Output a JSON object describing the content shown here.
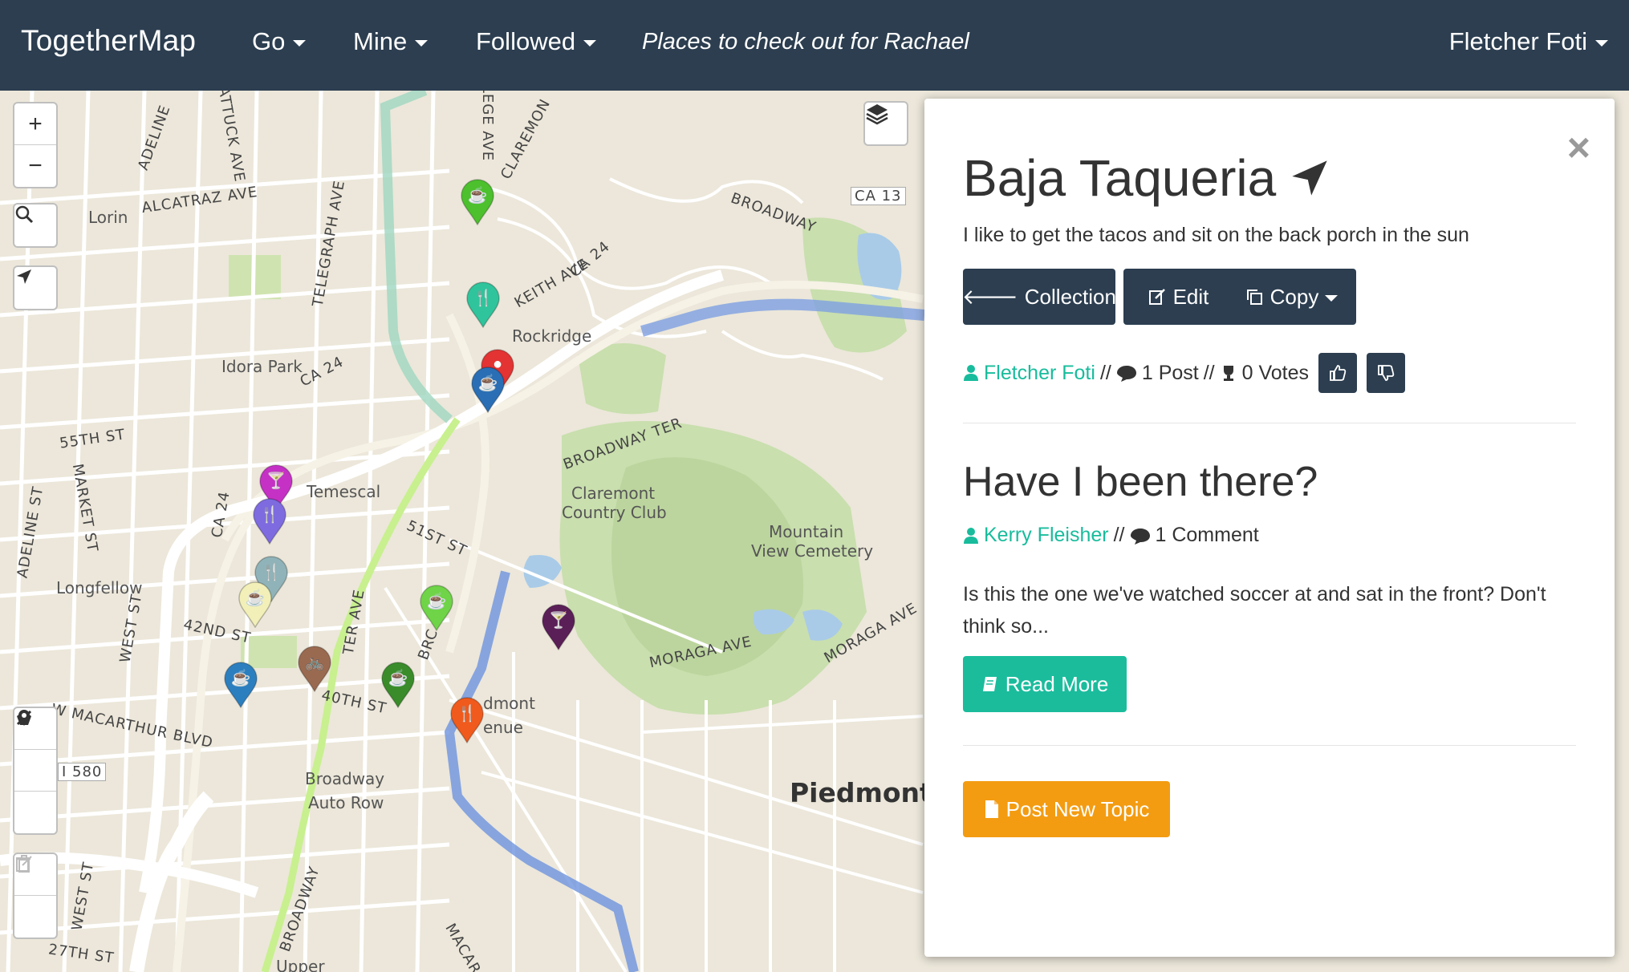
{
  "nav": {
    "brand": "TogetherMap",
    "go": "Go",
    "mine": "Mine",
    "followed": "Followed",
    "map_title": "Places to check out for Rachael",
    "user": "Fletcher Foti",
    "bg_color": "#2c3e50"
  },
  "map": {
    "controls": {
      "zoom_in": "+",
      "zoom_out": "−"
    },
    "labels": {
      "rockridge": "Rockridge",
      "idora_park": "Idora Park",
      "temescal": "Temescal",
      "longfellow": "Longfellow",
      "claremont": "Claremont",
      "country_club": "Country Club",
      "mountain": "Mountain",
      "view_cemetery": "View Cemetery",
      "piedmont": "Piedmont",
      "broadway": "Broadway",
      "auto_row": "Auto Row",
      "piedmont_ave_1": "dmont",
      "piedmont_ave_2": "enue",
      "upper": "Upper",
      "lorin": "Lorin",
      "alcatraz": "ALCATRAZ AVE",
      "adeline": "ADELINE",
      "telegraph": "TELEGRAPH AVE",
      "st_55": "55TH ST",
      "market": "MARKET ST",
      "st_51": "51ST ST",
      "st_42": "42ND ST",
      "st_40": "40TH ST",
      "macarthur": "W MACARTHUR BLVD",
      "i580": "I 580",
      "broadway_ter": "BROADWAY TER",
      "broadway_st": "BROADWAY",
      "keith": "KEITH AVE",
      "ca24_a": "CA 24",
      "ca24_b": "CA 24",
      "ca24_c": "CA 24",
      "ca13": "CA 13",
      "moraga_1": "MORAGA AVE",
      "moraga_2": "MORAGA AVE",
      "west_st": "WEST ST",
      "west_st2": "WEST ST",
      "st_27": "27TH ST",
      "claremont_ave": "CLAREMON",
      "college": "LEGE AVE",
      "shattuck": "ATTUCK AVE",
      "adeline_st": "ADELINE ST",
      "broadway_s": "BROADWAY",
      "macar": "MACAR",
      "ter_ave": "TER AVE",
      "brc": "BRC"
    },
    "markers": [
      {
        "color": "#4cc02d",
        "icon": "coffee-icon"
      },
      {
        "color": "#2fc49c",
        "icon": "fork-knife-icon"
      },
      {
        "color": "#e33333",
        "icon": "pin-icon"
      },
      {
        "color": "#2a6fb5",
        "icon": "coffee-icon"
      },
      {
        "color": "#c531c5",
        "icon": "cocktail-icon"
      },
      {
        "color": "#7e6be0",
        "icon": "fork-knife-icon"
      },
      {
        "color": "#8fb3b8",
        "icon": "fork-knife-icon"
      },
      {
        "color": "#f2f0b8",
        "icon": "coffee-icon"
      },
      {
        "color": "#6fd447",
        "icon": "coffee-icon"
      },
      {
        "color": "#5b1f58",
        "icon": "cocktail-icon"
      },
      {
        "color": "#2c7fbf",
        "icon": "coffee-icon"
      },
      {
        "color": "#9a6a50",
        "icon": "bicycle-icon"
      },
      {
        "color": "#3a8c2a",
        "icon": "coffee-icon"
      },
      {
        "color": "#f05a1c",
        "icon": "fork-knife-icon"
      }
    ]
  },
  "panel": {
    "place_title": "Baja Taqueria",
    "description": "I like to get the tacos and sit on the back porch in the sun",
    "buttons": {
      "collection": "Collection",
      "edit": "Edit",
      "copy": "Copy"
    },
    "meta": {
      "author": "Fletcher Foti",
      "sep1": "//",
      "posts": "1 Post",
      "sep2": "//",
      "votes": "0 Votes"
    },
    "topic": {
      "title": "Have I been there?",
      "author": "Kerry Fleisher",
      "sep": "//",
      "comments": "1 Comment",
      "body": "Is this the one we've watched soccer at and sat in the front? Don't think so...",
      "read_more": "Read More"
    },
    "post_new_topic": "Post New Topic",
    "close": "×"
  }
}
